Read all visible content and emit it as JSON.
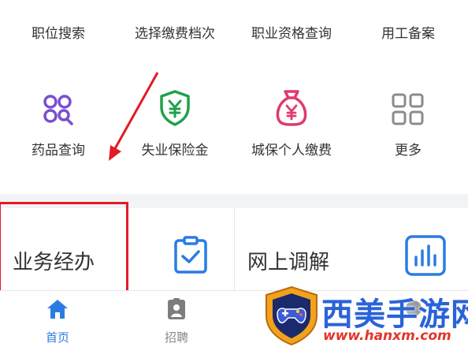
{
  "services_row1": [
    {
      "label": "职位搜索"
    },
    {
      "label": "选择缴费档次"
    },
    {
      "label": "职业资格查询"
    },
    {
      "label": "用工备案"
    }
  ],
  "services_row2": [
    {
      "label": "药品查询",
      "icon": "pill-search-icon"
    },
    {
      "label": "失业保险金",
      "icon": "shield-yuan-icon"
    },
    {
      "label": "城保个人缴费",
      "icon": "money-bag-icon"
    },
    {
      "label": "更多",
      "icon": "grid-more-icon"
    }
  ],
  "business": {
    "left_title": "业务经办",
    "right_title": "网上调解"
  },
  "tabbar": [
    {
      "label": "首页",
      "icon": "home-icon",
      "active": true
    },
    {
      "label": "招聘",
      "icon": "id-card-icon",
      "active": false
    },
    {
      "label": "",
      "icon": "tab-icon",
      "active": false
    },
    {
      "label": "",
      "icon": "tab-icon",
      "active": false
    },
    {
      "label": "",
      "icon": "tab-icon",
      "active": false
    }
  ],
  "watermark": {
    "brand": "西美手游网",
    "url": "www.hanxm.com"
  },
  "colors": {
    "blue": "#2a7ce3",
    "purple": "#7a4fd1",
    "green": "#1fa14a",
    "pink": "#e03a6b",
    "gray_icon": "#8b8b8b",
    "annotation_red": "#e21b25"
  }
}
